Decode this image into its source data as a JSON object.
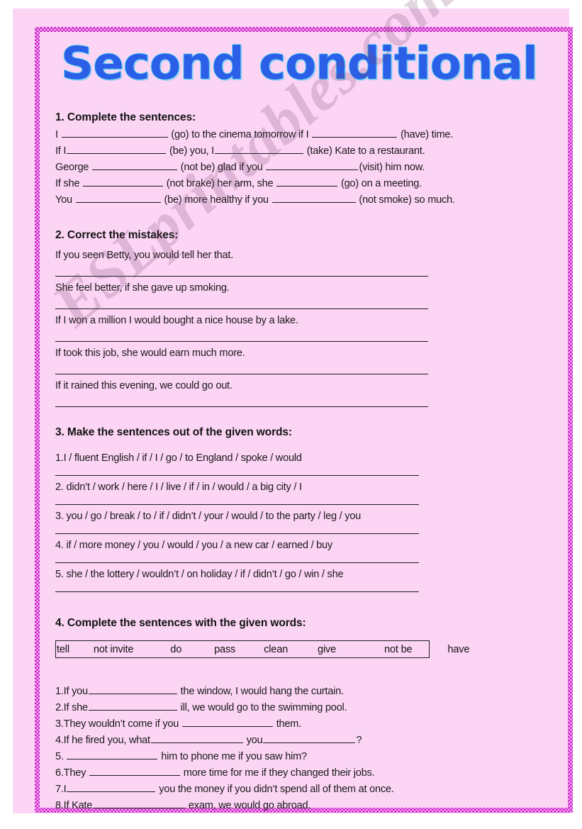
{
  "document": {
    "title": "Second conditional",
    "watermark": "ESLprintables.com"
  },
  "colors": {
    "page_background": "#ffffff",
    "sheet_background": "#fcd5f5",
    "frame_magenta": "#c918c9",
    "frame_light": "#f7b4f0",
    "title_blue": "#2b5fe8",
    "title_outline": "#66d9f2",
    "text": "#141414"
  },
  "sections": {
    "s1": {
      "heading": "1. Complete the sentences:",
      "items": [
        {
          "parts": [
            "I ",
            "BLANK:150",
            " (go) to the cinema tomorrow if I ",
            "BLANK:120",
            " (have) time."
          ]
        },
        {
          "parts": [
            "If I",
            "BLANK:140",
            " (be)  you, I",
            "BLANK:125",
            " (take) Kate to a restaurant."
          ]
        },
        {
          "parts": [
            "George ",
            "BLANK:120",
            " (not be) glad if you ",
            "BLANK:130",
            "(visit) him now."
          ]
        },
        {
          "parts": [
            "If she ",
            "BLANK:113",
            " (not brake) her arm, she ",
            "BLANK:86",
            " (go) on a meeting."
          ]
        },
        {
          "parts": [
            "You ",
            "BLANK:120",
            " (be) more healthy if you ",
            "BLANK:118",
            " (not smoke) so much."
          ]
        }
      ]
    },
    "s2": {
      "heading": "2. Correct the mistakes:",
      "items": [
        "If you seen Betty, you would tell her that.",
        "She feel better, if she gave up smoking.",
        "If I won a million I would bought a nice house by a lake.",
        "If took this job, she would earn much more.",
        "If it rained this evening, we could go out."
      ]
    },
    "s3": {
      "heading": "3. Make the sentences out of the given words:",
      "items": [
        "1.I / fluent English / if / I / go / to England / spoke / would",
        "2. didn’t / work / here / I / live / if / in / would / a big city / I",
        "3. you / go / break / to / if / didn’t / your / would / to the party / leg / you",
        "4. if / more money / you / would / you / a new car / earned / buy",
        "5. she / the lottery / wouldn’t / on holiday / if / didn’t / go / win / she"
      ]
    },
    "s4": {
      "heading": "4. Complete the sentences with the given words:",
      "word_bank": [
        "tell",
        "not invite",
        "do",
        "pass",
        "clean",
        "give",
        "not be",
        "have"
      ],
      "items": [
        {
          "parts": [
            "1.If you",
            "BLANK:125",
            " the window, I would hang the curtain."
          ]
        },
        {
          "parts": [
            "2.If she",
            "BLANK:125",
            " ill, we would go to the swimming pool."
          ]
        },
        {
          "parts": [
            "3.They wouldn’t come if you ",
            "BLANK:128",
            " them."
          ]
        },
        {
          "parts": [
            "4.If he fired you, what",
            "BLANK:130",
            " you",
            "BLANK:130",
            "?"
          ]
        },
        {
          "parts": [
            "5. ",
            "BLANK:128",
            " him to phone me if you saw him?"
          ]
        },
        {
          "parts": [
            "6.They ",
            "BLANK:128",
            " more time for me if they changed their jobs."
          ]
        },
        {
          "parts": [
            "7.I",
            "BLANK:125",
            " you the money if you didn’t spend all of them at once."
          ]
        },
        {
          "parts": [
            "8.If Kate",
            "BLANK:130",
            " exam, we would go abroad."
          ]
        }
      ]
    }
  }
}
